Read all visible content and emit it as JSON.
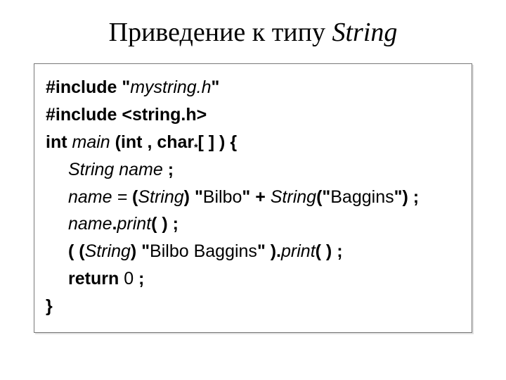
{
  "title": {
    "prefix": "Приведение к типу ",
    "italic": "String"
  },
  "code": {
    "l1": {
      "a": "#include \"",
      "b": "mystring.h",
      "c": "\""
    },
    "l2": {
      "a": "#include <string.h>"
    },
    "l3": {
      "a": "int ",
      "b": "main",
      "c": " (int , char",
      "sub": "*",
      "d": "[ ] ) {"
    },
    "l4": {
      "a": "String name",
      "b": " ;"
    },
    "l5": {
      "a": "name = ",
      "b": "(",
      "c": "String",
      "d": ") \"",
      "e": "Bilbo",
      "f": "\" + ",
      "g": "String",
      "h": "(\"",
      "i": "Baggins",
      "j": "\") ;"
    },
    "l6": {
      "a": "name",
      "b": ".",
      "c": "print",
      "d": "( ) ;"
    },
    "l7": {
      "a": "( (",
      "b": "String",
      "c": ") \"",
      "d": "Bilbo Baggins",
      "e": "\" ).",
      "f": "print",
      "g": "( ) ;"
    },
    "l8": {
      "a": "return ",
      "b": "0",
      "c": " ;"
    },
    "l9": {
      "a": "}"
    }
  }
}
